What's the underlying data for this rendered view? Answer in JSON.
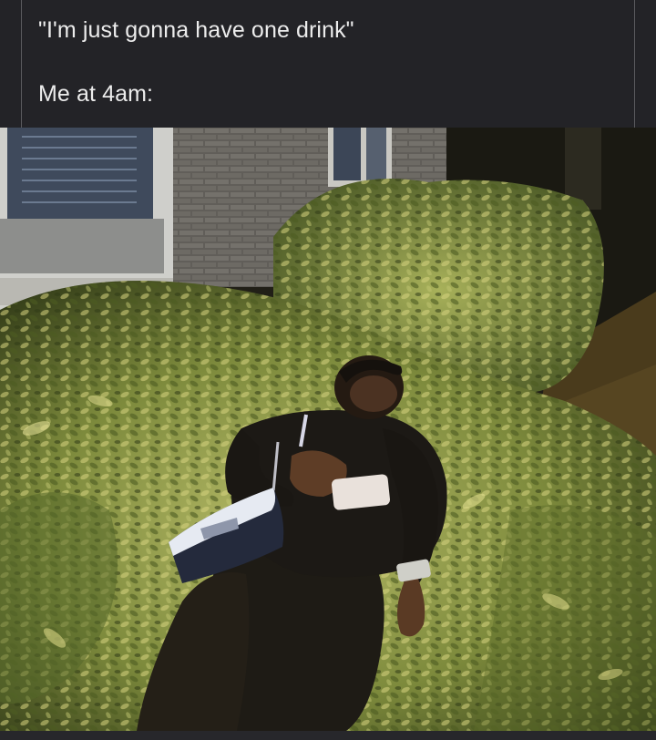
{
  "post": {
    "caption_line_1": "\"I'm just gonna have one drink\"",
    "caption_line_2": "Me at 4am:"
  },
  "photo": {
    "subject": "woman asleep on top of hedge bushes at night",
    "phone_icon": "phone-icon",
    "handbag_icon": "handbag-icon"
  },
  "colors": {
    "background": "#222226",
    "caption_text": "#ececec",
    "border": "#5a5a5e"
  }
}
